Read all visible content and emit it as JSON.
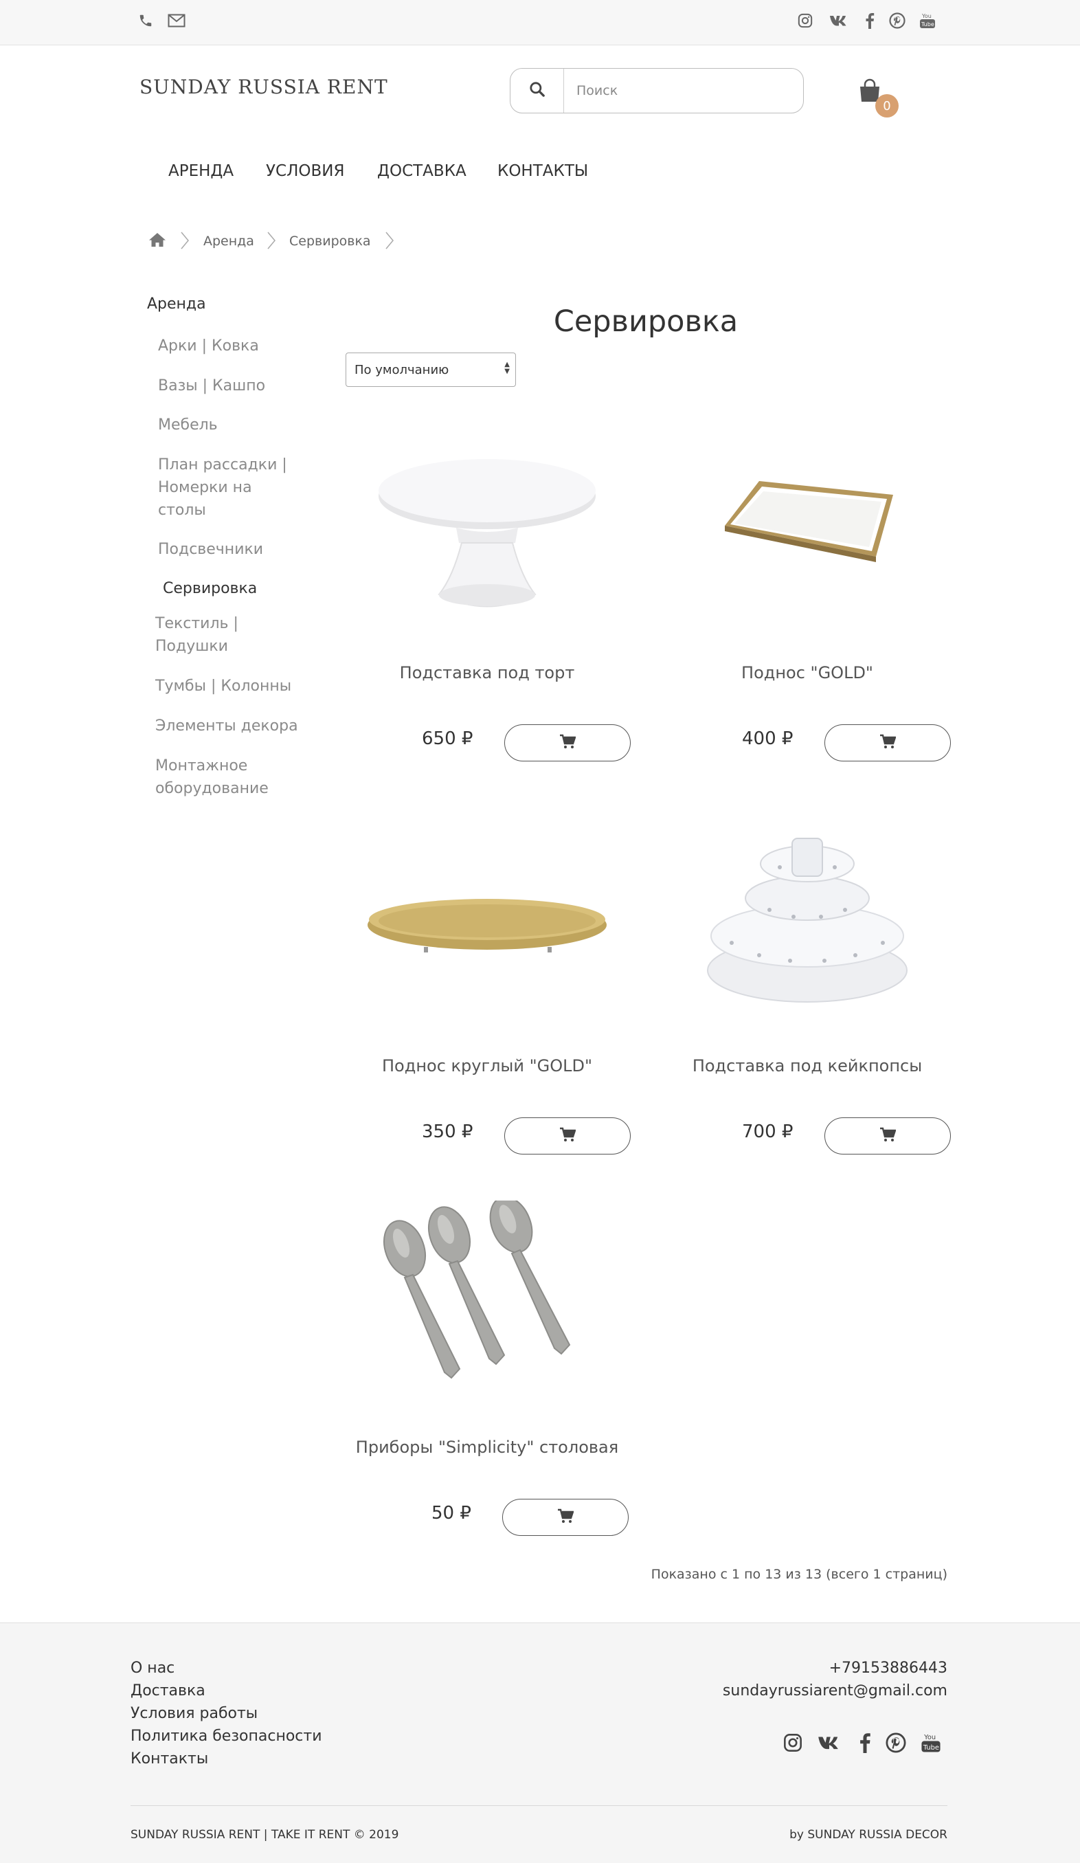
{
  "topbar": {
    "icons_left": [
      "phone-icon",
      "mail-icon"
    ],
    "icons_right": [
      "instagram-icon",
      "vk-icon",
      "facebook-icon",
      "pinterest-icon",
      "youtube-icon"
    ]
  },
  "header": {
    "logo": "SUNDAY RUSSIA RENT",
    "search_placeholder": "Поиск",
    "cart_count": "0"
  },
  "nav": [
    "АРЕНДА",
    "УСЛОВИЯ",
    "ДОСТАВКА",
    "КОНТАКТЫ"
  ],
  "breadcrumb": [
    "Аренда",
    "Сервировка"
  ],
  "sidebar": {
    "title": "Аренда",
    "items": [
      "Арки | Ковка",
      "Вазы | Кашпо",
      "Мебель",
      "План рассадки | Номерки на столы",
      "Подсвечники",
      "Сервировка",
      "Текстиль | Подушки",
      "Тумбы | Колонны",
      "Элементы декора",
      "Монтажное оборудование"
    ],
    "active_item": "Сервировка"
  },
  "main": {
    "title": "Сервировка",
    "sort_selected": "По умолчанию",
    "products": [
      {
        "name": "Подставка под торт",
        "price": "650 ₽",
        "image": "cake-stand"
      },
      {
        "name": "Поднос \"GOLD\"",
        "price": "400 ₽",
        "image": "mirror-tray"
      },
      {
        "name": "Поднос круглый \"GOLD\"",
        "price": "350 ₽",
        "image": "round-gold-tray"
      },
      {
        "name": "Подставка под кейкпопсы",
        "price": "700 ₽",
        "image": "cakepop-stand"
      },
      {
        "name": "Приборы \"Simplicity\" столовая",
        "price": "50 ₽",
        "image": "spoons"
      }
    ],
    "pagination_text": "Показано с 1 по 13 из 13 (всего 1 страниц)"
  },
  "footer": {
    "links": [
      "О нас",
      "Доставка",
      "Условия работы",
      "Политика безопасности",
      "Контакты"
    ],
    "phone": "+79153886443",
    "email": "sundayrussiarent@gmail.com",
    "social_icons": [
      "instagram-icon",
      "vk-icon",
      "facebook-icon",
      "pinterest-icon",
      "youtube-icon"
    ],
    "copyright_left": "SUNDAY RUSSIA RENT | TAKE IT RENT © 2019",
    "copyright_right": "by SUNDAY RUSSIA DECOR"
  },
  "colors": {
    "badge": "#d8a070",
    "topbar_bg": "#f7f7f7",
    "footer_bg": "#f5f5f5"
  }
}
